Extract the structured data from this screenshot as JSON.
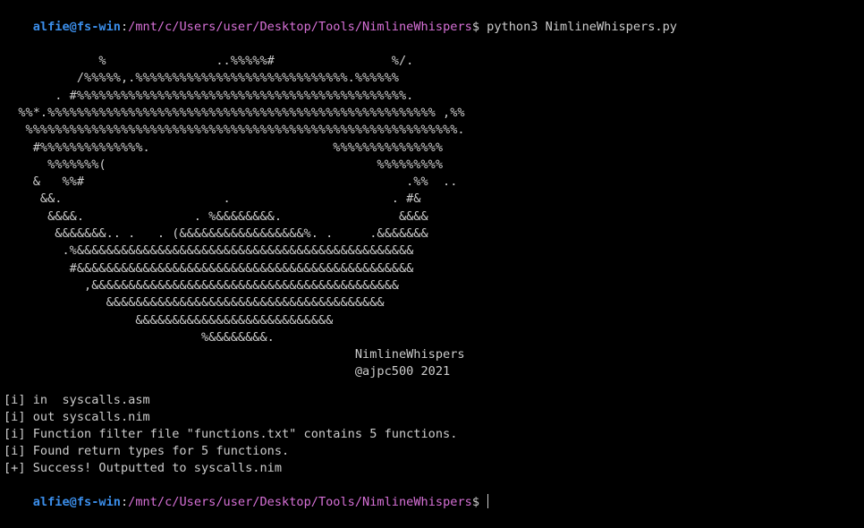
{
  "terminal": {
    "prompt1": {
      "user_host": "alfie@fs-win",
      "separator": ":",
      "path": "/mnt/c/Users/user/Desktop/Tools/NimlineWhispers",
      "symbol": "$",
      "command": " python3 NimlineWhispers.py"
    },
    "banner_lines": [
      "             %               ..%%%%%#                %/.",
      "          /%%%%%,.%%%%%%%%%%%%%%%%%%%%%%%%%%%%%.%%%%%%",
      "       . #%%%%%%%%%%%%%%%%%%%%%%%%%%%%%%%%%%%%%%%%%%%%%.",
      "  %%*.%%%%%%%%%%%%%%%%%%%%%%%%%%%%%%%%%%%%%%%%%%%%%%%%%%%%% ,%%",
      "   %%%%%%%%%%%%%%%%%%%%%%%%%%%%%%%%%%%%%%%%%%%%%%%%%%%%%%%%%%%.",
      "    #%%%%%%%%%%%%%%.                         %%%%%%%%%%%%%%%",
      "      %%%%%%%(                                     %%%%%%%%%",
      "    &   %%#                                            .%%  ..",
      "     &&.                      .                      . #&",
      "      &&&&.               . %&&&&&&&&.                &&&&",
      "       &&&&&&&.. .   . (&&&&&&&&&&&&&&&&&%. .     .&&&&&&&",
      "        .%&&&&&&&&&&&&&&&&&&&&&&&&&&&&&&&&&&&&&&&&&&&&&&",
      "         #&&&&&&&&&&&&&&&&&&&&&&&&&&&&&&&&&&&&&&&&&&&&&&",
      "           ,&&&&&&&&&&&&&&&&&&&&&&&&&&&&&&&&&&&&&&&&&&",
      "              &&&&&&&&&&&&&&&&&&&&&&&&&&&&&&&&&&&&&&",
      "                  &&&&&&&&&&&&&&&&&&&&&&&&&&&",
      "                           %&&&&&&&&.",
      "                                                NimlineWhispers",
      "                                                @ajpc500 2021"
    ],
    "output_lines": [
      "[i] in  syscalls.asm",
      "[i] out syscalls.nim",
      "[i] Function filter file \"functions.txt\" contains 5 functions.",
      "[i] Found return types for 5 functions.",
      "[+] Success! Outputted to syscalls.nim"
    ],
    "prompt2": {
      "user_host": "alfie@fs-win",
      "separator": ":",
      "path": "/mnt/c/Users/user/Desktop/Tools/NimlineWhispers",
      "symbol": "$",
      "command": " "
    },
    "colors": {
      "background": "#000000",
      "text": "#cccccc",
      "user_host": "#3b8eea",
      "path": "#d670d6"
    }
  }
}
